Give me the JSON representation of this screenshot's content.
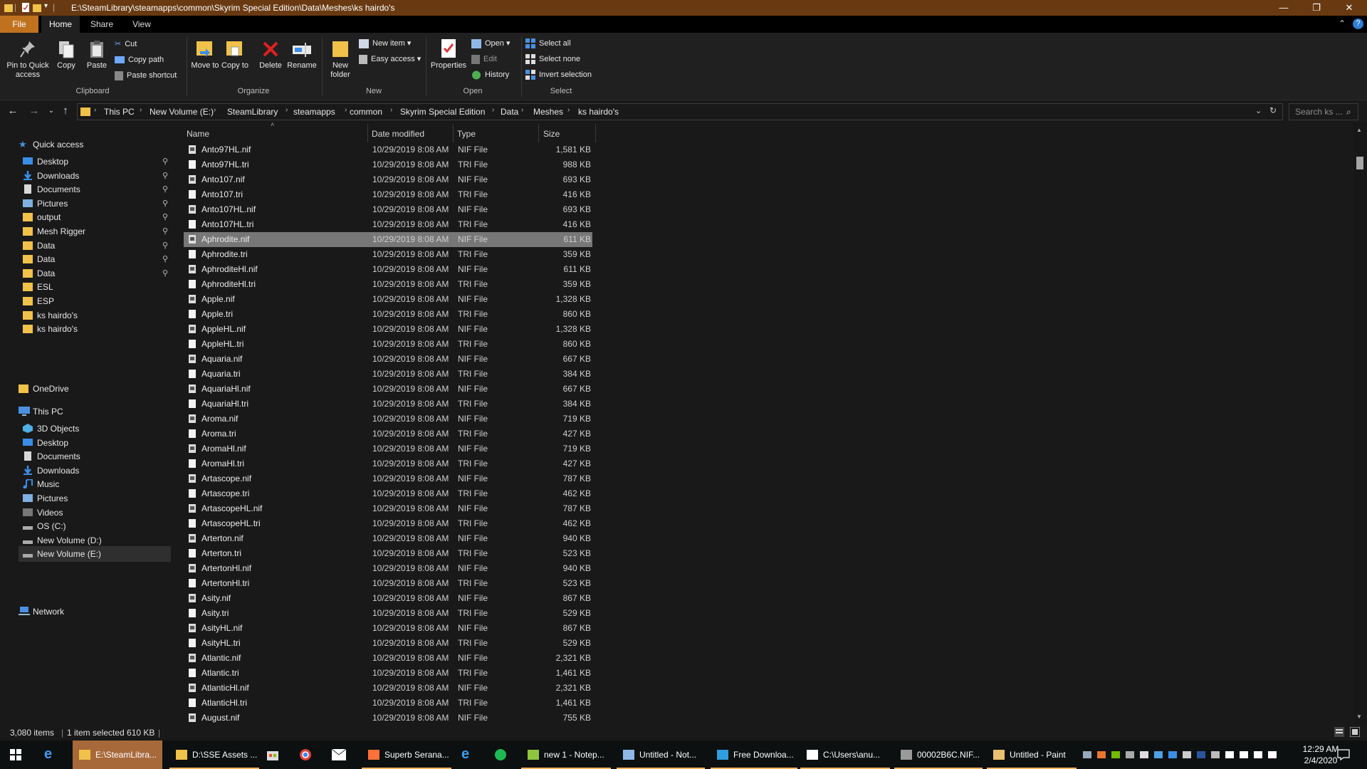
{
  "window": {
    "title": "E:\\SteamLibrary\\steamapps\\common\\Skyrim Special Edition\\Data\\Meshes\\ks hairdo's",
    "controls": {
      "minimize": "—",
      "restore": "❐",
      "close": "✕"
    }
  },
  "ribbon_tabs": [
    "File",
    "Home",
    "Share",
    "View"
  ],
  "ribbon": {
    "clipboard": {
      "pin": "Pin to Quick access",
      "copy": "Copy",
      "paste": "Paste",
      "cut": "Cut",
      "copy_path": "Copy path",
      "paste_shortcut": "Paste shortcut",
      "label": "Clipboard"
    },
    "organize": {
      "move_to": "Move to",
      "copy_to": "Copy to",
      "delete": "Delete",
      "rename": "Rename",
      "label": "Organize"
    },
    "new": {
      "new_folder": "New folder",
      "new_item": "New item",
      "easy_access": "Easy access",
      "label": "New"
    },
    "open": {
      "properties": "Properties",
      "open": "Open",
      "edit": "Edit",
      "history": "History",
      "label": "Open"
    },
    "select": {
      "select_all": "Select all",
      "select_none": "Select none",
      "invert": "Invert selection",
      "label": "Select"
    }
  },
  "address": {
    "breadcrumbs": [
      "This PC",
      "New Volume (E:)",
      "SteamLibrary",
      "steamapps",
      "common",
      "Skyrim Special Edition",
      "Data",
      "Meshes",
      "ks hairdo's"
    ],
    "search_placeholder": "Search ks ..."
  },
  "nav": {
    "quick_access": "Quick access",
    "quick_items": [
      {
        "label": "Desktop",
        "pinned": true,
        "icon": "desktop-icon"
      },
      {
        "label": "Downloads",
        "pinned": true,
        "icon": "download-icon"
      },
      {
        "label": "Documents",
        "pinned": true,
        "icon": "documents-icon"
      },
      {
        "label": "Pictures",
        "pinned": true,
        "icon": "pictures-icon"
      },
      {
        "label": "output",
        "pinned": true,
        "icon": "folder-icon"
      },
      {
        "label": "Mesh Rigger",
        "pinned": true,
        "icon": "folder-icon"
      },
      {
        "label": "Data",
        "pinned": true,
        "icon": "folder-icon"
      },
      {
        "label": "Data",
        "pinned": true,
        "icon": "folder-icon"
      },
      {
        "label": "Data",
        "pinned": true,
        "icon": "folder-icon"
      },
      {
        "label": "ESL",
        "pinned": false,
        "icon": "folder-icon"
      },
      {
        "label": "ESP",
        "pinned": false,
        "icon": "folder-icon"
      },
      {
        "label": "ks hairdo's",
        "pinned": false,
        "icon": "folder-icon"
      },
      {
        "label": "ks hairdo's",
        "pinned": false,
        "icon": "folder-icon"
      }
    ],
    "onedrive": "OneDrive",
    "this_pc": "This PC",
    "pc_items": [
      {
        "label": "3D Objects",
        "icon": "3d-objects-icon"
      },
      {
        "label": "Desktop",
        "icon": "desktop-icon"
      },
      {
        "label": "Documents",
        "icon": "documents-icon"
      },
      {
        "label": "Downloads",
        "icon": "download-icon"
      },
      {
        "label": "Music",
        "icon": "music-icon"
      },
      {
        "label": "Pictures",
        "icon": "pictures-icon"
      },
      {
        "label": "Videos",
        "icon": "videos-icon"
      },
      {
        "label": "OS (C:)",
        "icon": "drive-icon"
      },
      {
        "label": "New Volume (D:)",
        "icon": "drive-icon"
      },
      {
        "label": "New Volume (E:)",
        "icon": "drive-icon"
      }
    ],
    "selected": "New Volume (E:)",
    "network": "Network"
  },
  "columns": [
    "Name",
    "Date modified",
    "Type",
    "Size"
  ],
  "files": [
    [
      "Anto97HL.nif",
      "10/29/2019 8:08 AM",
      "NIF File",
      "1,581 KB"
    ],
    [
      "Anto97HL.tri",
      "10/29/2019 8:08 AM",
      "TRI File",
      "988 KB"
    ],
    [
      "Anto107.nif",
      "10/29/2019 8:08 AM",
      "NIF File",
      "693 KB"
    ],
    [
      "Anto107.tri",
      "10/29/2019 8:08 AM",
      "TRI File",
      "416 KB"
    ],
    [
      "Anto107HL.nif",
      "10/29/2019 8:08 AM",
      "NIF File",
      "693 KB"
    ],
    [
      "Anto107HL.tri",
      "10/29/2019 8:08 AM",
      "TRI File",
      "416 KB"
    ],
    [
      "Aphrodite.nif",
      "10/29/2019 8:08 AM",
      "NIF File",
      "611 KB"
    ],
    [
      "Aphrodite.tri",
      "10/29/2019 8:08 AM",
      "TRI File",
      "359 KB"
    ],
    [
      "AphroditeHl.nif",
      "10/29/2019 8:08 AM",
      "NIF File",
      "611 KB"
    ],
    [
      "AphroditeHl.tri",
      "10/29/2019 8:08 AM",
      "TRI File",
      "359 KB"
    ],
    [
      "Apple.nif",
      "10/29/2019 8:08 AM",
      "NIF File",
      "1,328 KB"
    ],
    [
      "Apple.tri",
      "10/29/2019 8:08 AM",
      "TRI File",
      "860 KB"
    ],
    [
      "AppleHL.nif",
      "10/29/2019 8:08 AM",
      "NIF File",
      "1,328 KB"
    ],
    [
      "AppleHL.tri",
      "10/29/2019 8:08 AM",
      "TRI File",
      "860 KB"
    ],
    [
      "Aquaria.nif",
      "10/29/2019 8:08 AM",
      "NIF File",
      "667 KB"
    ],
    [
      "Aquaria.tri",
      "10/29/2019 8:08 AM",
      "TRI File",
      "384 KB"
    ],
    [
      "AquariaHl.nif",
      "10/29/2019 8:08 AM",
      "NIF File",
      "667 KB"
    ],
    [
      "AquariaHl.tri",
      "10/29/2019 8:08 AM",
      "TRI File",
      "384 KB"
    ],
    [
      "Aroma.nif",
      "10/29/2019 8:08 AM",
      "NIF File",
      "719 KB"
    ],
    [
      "Aroma.tri",
      "10/29/2019 8:08 AM",
      "TRI File",
      "427 KB"
    ],
    [
      "AromaHl.nif",
      "10/29/2019 8:08 AM",
      "NIF File",
      "719 KB"
    ],
    [
      "AromaHl.tri",
      "10/29/2019 8:08 AM",
      "TRI File",
      "427 KB"
    ],
    [
      "Artascope.nif",
      "10/29/2019 8:08 AM",
      "NIF File",
      "787 KB"
    ],
    [
      "Artascope.tri",
      "10/29/2019 8:08 AM",
      "TRI File",
      "462 KB"
    ],
    [
      "ArtascopeHL.nif",
      "10/29/2019 8:08 AM",
      "NIF File",
      "787 KB"
    ],
    [
      "ArtascopeHL.tri",
      "10/29/2019 8:08 AM",
      "TRI File",
      "462 KB"
    ],
    [
      "Arterton.nif",
      "10/29/2019 8:08 AM",
      "NIF File",
      "940 KB"
    ],
    [
      "Arterton.tri",
      "10/29/2019 8:08 AM",
      "TRI File",
      "523 KB"
    ],
    [
      "ArtertonHl.nif",
      "10/29/2019 8:08 AM",
      "NIF File",
      "940 KB"
    ],
    [
      "ArtertonHl.tri",
      "10/29/2019 8:08 AM",
      "TRI File",
      "523 KB"
    ],
    [
      "Asity.nif",
      "10/29/2019 8:08 AM",
      "NIF File",
      "867 KB"
    ],
    [
      "Asity.tri",
      "10/29/2019 8:08 AM",
      "TRI File",
      "529 KB"
    ],
    [
      "AsityHL.nif",
      "10/29/2019 8:08 AM",
      "NIF File",
      "867 KB"
    ],
    [
      "AsityHL.tri",
      "10/29/2019 8:08 AM",
      "TRI File",
      "529 KB"
    ],
    [
      "Atlantic.nif",
      "10/29/2019 8:08 AM",
      "NIF File",
      "2,321 KB"
    ],
    [
      "Atlantic.tri",
      "10/29/2019 8:08 AM",
      "TRI File",
      "1,461 KB"
    ],
    [
      "AtlanticHl.nif",
      "10/29/2019 8:08 AM",
      "NIF File",
      "2,321 KB"
    ],
    [
      "AtlanticHl.tri",
      "10/29/2019 8:08 AM",
      "TRI File",
      "1,461 KB"
    ],
    [
      "August.nif",
      "10/29/2019 8:08 AM",
      "NIF File",
      "755 KB"
    ]
  ],
  "selected_file": "Aphrodite.nif",
  "status": {
    "items": "3,080 items",
    "selected": "1 item selected  610 KB"
  },
  "taskbar": {
    "items": [
      {
        "label": "E:\\SteamLibra...",
        "icon": "explorer-icon",
        "active": true
      },
      {
        "label": "D:\\SSE Assets ...",
        "icon": "explorer-icon",
        "active": false
      },
      {
        "label": "Superb Serana...",
        "icon": "firefox-icon",
        "active": false
      },
      {
        "label": "new 1 - Notep...",
        "icon": "notepadpp-icon",
        "active": false
      },
      {
        "label": "Untitled - Not...",
        "icon": "notepad-icon",
        "active": false
      },
      {
        "label": "Free Downloa...",
        "icon": "download-manager-icon",
        "active": false
      },
      {
        "label": "C:\\Users\\anu...",
        "icon": "7zip-icon",
        "active": false
      },
      {
        "label": "00002B6C.NIF...",
        "icon": "nifskope-icon",
        "active": false
      },
      {
        "label": "Untitled - Paint",
        "icon": "paint-icon",
        "active": false
      }
    ],
    "time": "12:29 AM",
    "date": "2/4/2020"
  },
  "colors": {
    "titlebar": "#693a12",
    "file_tab": "#c0721f",
    "selection": "#777777",
    "taskbar_active": "#a8693a"
  }
}
